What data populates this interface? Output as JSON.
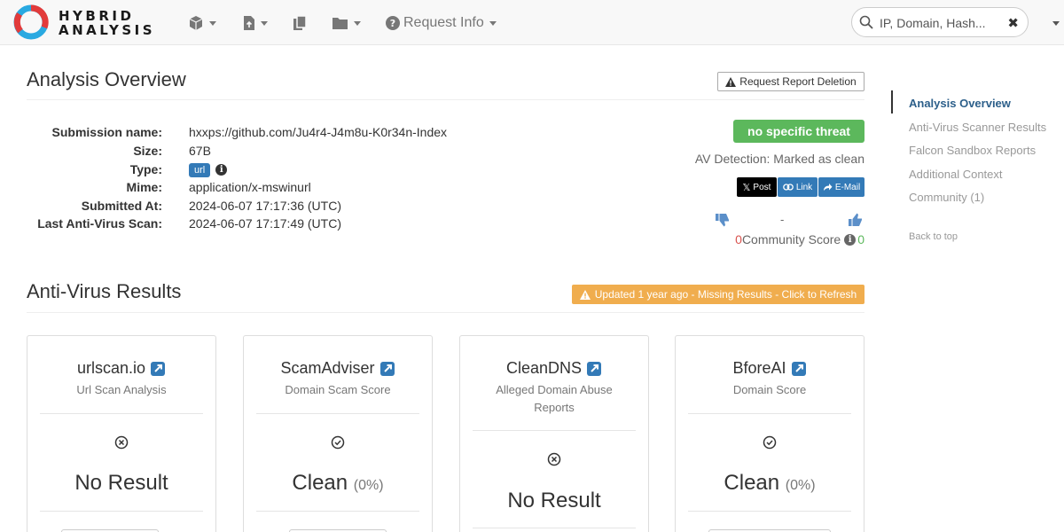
{
  "nav": {
    "logo_line1": "HYBRID",
    "logo_line2": "ANALYSIS",
    "request_info_label": "Request Info",
    "search_placeholder": "IP, Domain, Hash..."
  },
  "overview": {
    "title": "Analysis Overview",
    "deletion_button": "Request Report Deletion",
    "fields": [
      {
        "label": "Submission name:",
        "value": "hxxps://github.com/Ju4r4-J4m8u-K0r34n-Index"
      },
      {
        "label": "Size:",
        "value": "67B"
      },
      {
        "label": "Type:",
        "value": "url"
      },
      {
        "label": "Mime:",
        "value": "application/x-mswinurl"
      },
      {
        "label": "Submitted At:",
        "value": "2024-06-07 17:17:36 (UTC)"
      },
      {
        "label": "Last Anti-Virus Scan:",
        "value": "2024-06-07 17:17:49 (UTC)"
      }
    ],
    "threat_badge": "no specific threat",
    "av_detection": "AV Detection: Marked as clean",
    "share": {
      "post": "Post",
      "link": "Link",
      "email": "E-Mail"
    },
    "vote_separator": "-",
    "community_score_label": "Community Score",
    "downvotes": "0",
    "upvotes": "0"
  },
  "av_results": {
    "title": "Anti-Virus Results",
    "refresh_notice": "Updated 1 year ago - Missing Results - Click to Refresh",
    "cards": [
      {
        "name": "urlscan.io",
        "subtitle": "Url Scan Analysis",
        "status": "No Result",
        "percent": ""
      },
      {
        "name": "ScamAdviser",
        "subtitle": "Domain Scam Score",
        "status": "Clean",
        "percent": "(0%)"
      },
      {
        "name": "CleanDNS",
        "subtitle": "Alleged Domain Abuse Reports",
        "status": "No Result",
        "percent": ""
      },
      {
        "name": "BforeAI",
        "subtitle": "Domain Score",
        "status": "Clean",
        "percent": "(0%)"
      }
    ]
  },
  "sidebar": {
    "items": [
      {
        "label": "Analysis Overview"
      },
      {
        "label": "Anti-Virus Scanner Results"
      },
      {
        "label": "Falcon Sandbox Reports"
      },
      {
        "label": "Additional Context"
      },
      {
        "label": "Community (1)"
      }
    ],
    "back_to_top": "Back to top"
  },
  "colors": {
    "primary": "#337ab7",
    "success": "#5cb85c",
    "warning": "#f0ad4e",
    "danger": "#d9534f",
    "sidebar_active": "#2c5f8a"
  }
}
